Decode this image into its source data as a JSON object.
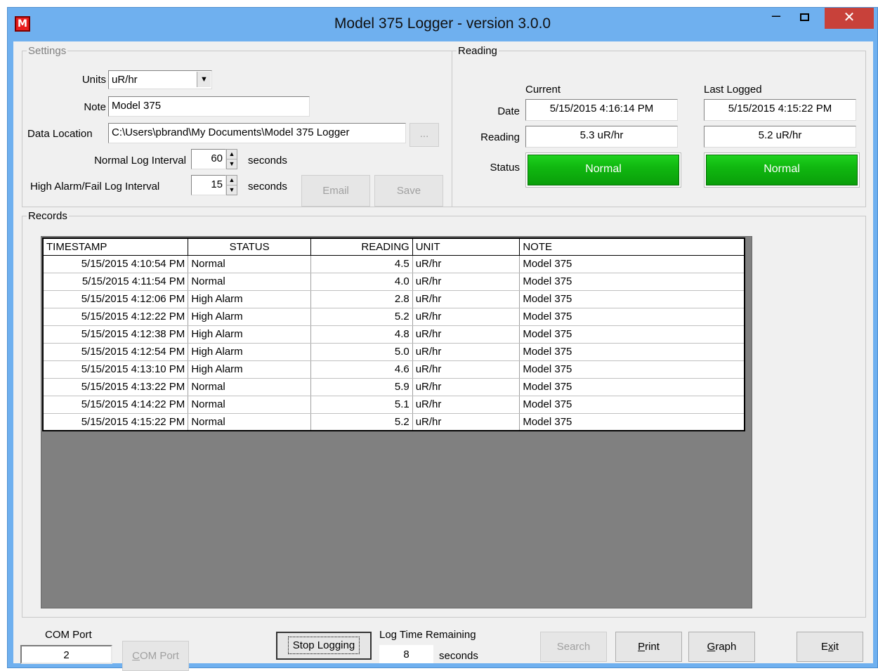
{
  "window": {
    "title": "Model 375 Logger - version 3.0.0",
    "icon_letter": "M",
    "minimize": "–",
    "close": "✕"
  },
  "settings": {
    "legend": "Settings",
    "units_label": "Units",
    "units_value": "uR/hr",
    "note_label": "Note",
    "note_value": "Model 375",
    "data_location_label": "Data Location",
    "data_location_value": "C:\\Users\\pbrand\\My Documents\\Model 375 Logger",
    "browse_label": "...",
    "normal_interval_label": "Normal Log Interval",
    "normal_interval_value": "60",
    "high_interval_label": "High Alarm/Fail Log Interval",
    "high_interval_value": "15",
    "seconds_label": "seconds",
    "email_label": "Email",
    "save_label": "Save"
  },
  "reading": {
    "legend": "Reading",
    "current_header": "Current",
    "last_header": "Last Logged",
    "date_label": "Date",
    "reading_label": "Reading",
    "status_label": "Status",
    "current_date": "5/15/2015 4:16:14 PM",
    "last_date": "5/15/2015 4:15:22 PM",
    "current_reading": "5.3 uR/hr",
    "last_reading": "5.2 uR/hr",
    "current_status": "Normal",
    "last_status": "Normal",
    "status_color": "#0fb20f"
  },
  "records": {
    "legend": "Records",
    "columns": [
      "TIMESTAMP",
      "STATUS",
      "READING",
      "UNIT",
      "NOTE"
    ],
    "rows": [
      [
        "5/15/2015 4:10:54 PM",
        "Normal",
        "4.5",
        "uR/hr",
        "Model 375"
      ],
      [
        "5/15/2015 4:11:54 PM",
        "Normal",
        "4.0",
        "uR/hr",
        "Model 375"
      ],
      [
        "5/15/2015 4:12:06 PM",
        "High Alarm",
        "2.8",
        "uR/hr",
        "Model 375"
      ],
      [
        "5/15/2015 4:12:22 PM",
        "High Alarm",
        "5.2",
        "uR/hr",
        "Model 375"
      ],
      [
        "5/15/2015 4:12:38 PM",
        "High Alarm",
        "4.8",
        "uR/hr",
        "Model 375"
      ],
      [
        "5/15/2015 4:12:54 PM",
        "High Alarm",
        "5.0",
        "uR/hr",
        "Model 375"
      ],
      [
        "5/15/2015 4:13:10 PM",
        "High Alarm",
        "4.6",
        "uR/hr",
        "Model 375"
      ],
      [
        "5/15/2015 4:13:22 PM",
        "Normal",
        "5.9",
        "uR/hr",
        "Model 375"
      ],
      [
        "5/15/2015 4:14:22 PM",
        "Normal",
        "5.1",
        "uR/hr",
        "Model 375"
      ],
      [
        "5/15/2015 4:15:22 PM",
        "Normal",
        "5.2",
        "uR/hr",
        "Model 375"
      ]
    ]
  },
  "bottom": {
    "com_port_label": "COM Port",
    "com_port_value": "2",
    "com_port_button": {
      "pre": "",
      "key": "C",
      "post": "OM Port"
    },
    "stop_logging_label": "Stop Logging",
    "log_time_label": "Log Time Remaining",
    "log_time_value": "8",
    "seconds_label": "seconds",
    "search_label": "Search",
    "print_button": {
      "pre": "",
      "key": "P",
      "post": "rint"
    },
    "graph_button": {
      "pre": "",
      "key": "G",
      "post": "raph"
    },
    "exit_button": {
      "pre": "E",
      "key": "x",
      "post": "it"
    }
  }
}
